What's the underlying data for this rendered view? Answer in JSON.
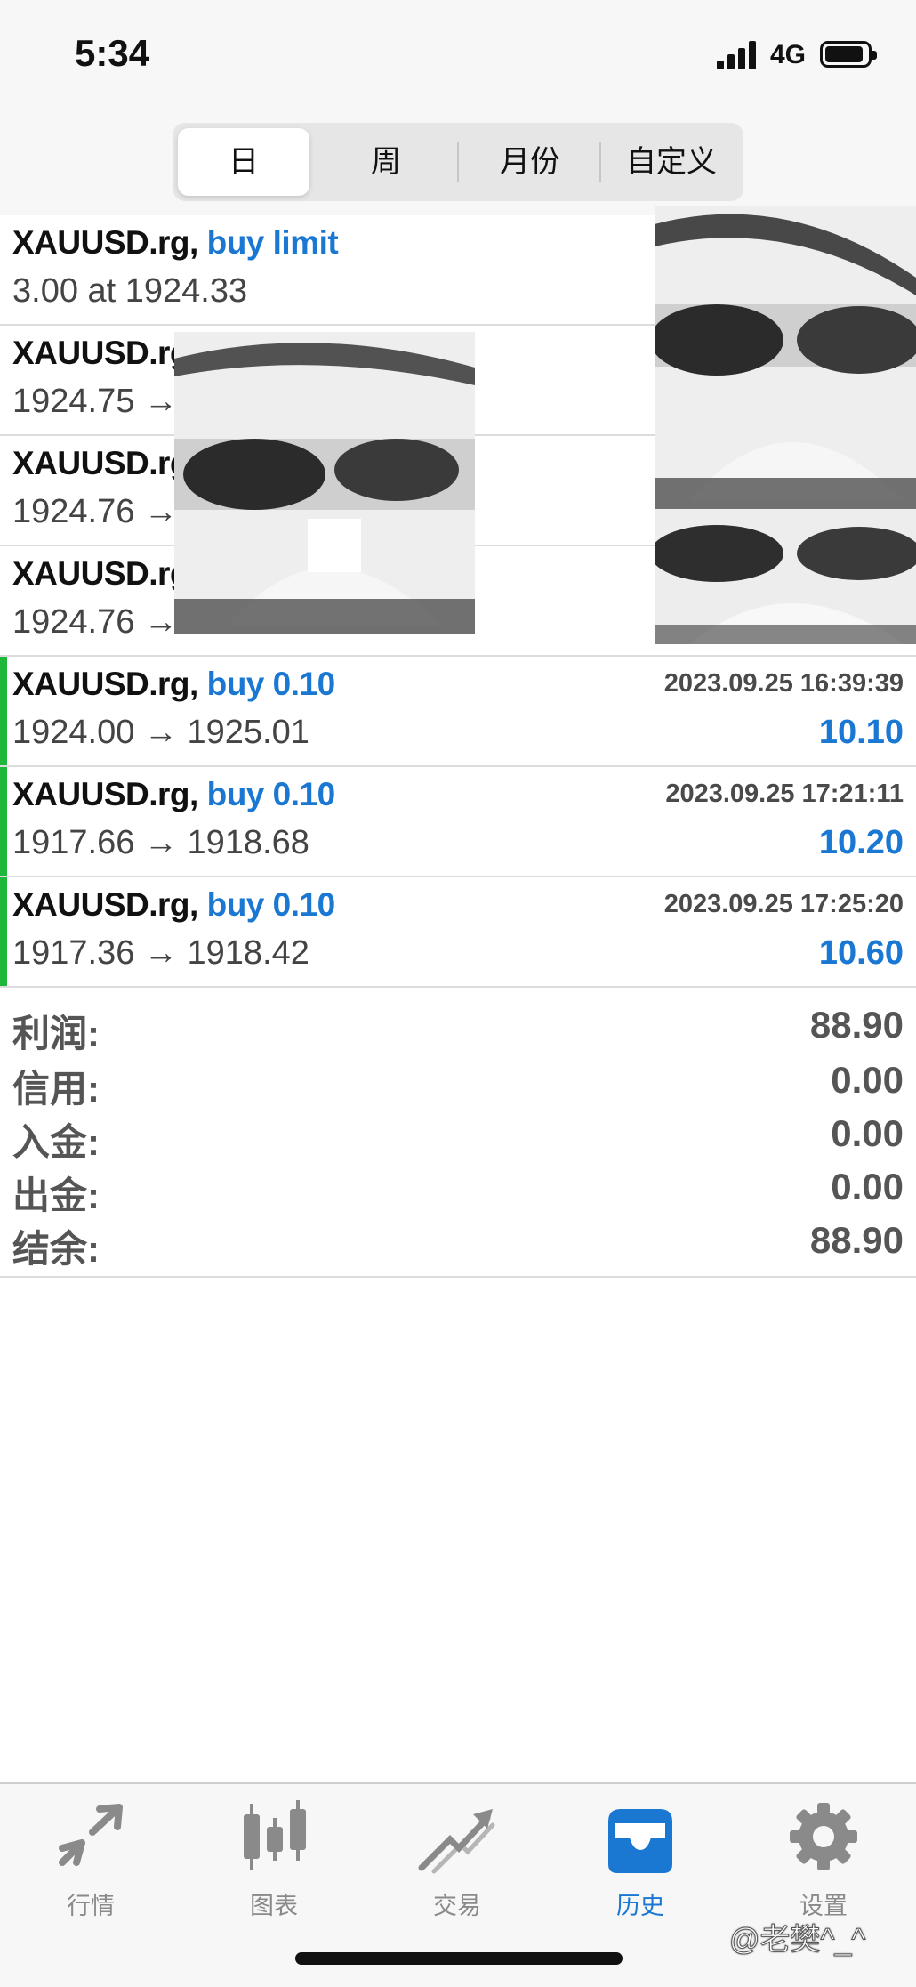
{
  "status_bar": {
    "time": "5:34",
    "network": "4G"
  },
  "tabs_period": {
    "options": [
      "日",
      "周",
      "月份",
      "自定义"
    ],
    "selected": "日"
  },
  "orders": [
    {
      "symbol": "XAUUSD.rg,",
      "action": "buy limit",
      "price_line": "3.00 at 1924.33",
      "date": "",
      "profit": ""
    },
    {
      "symbol": "XAUUSD.rg",
      "action": "",
      "price_line": "1924.75 →",
      "date": "",
      "profit": ""
    },
    {
      "symbol": "XAUUSD.rg",
      "action": "",
      "price_line": "1924.76 →",
      "date": "",
      "profit": ""
    },
    {
      "symbol": "XAUUSD.rg",
      "action": "",
      "price_line": "1924.76 →",
      "date": "",
      "profit": ""
    },
    {
      "symbol": "XAUUSD.rg,",
      "action": "buy 0.10",
      "price_line": "1924.00 → 1925.01",
      "date": "2023.09.25 16:39:39",
      "profit": "10.10"
    },
    {
      "symbol": "XAUUSD.rg,",
      "action": "buy 0.10",
      "price_line": "1917.66 → 1918.68",
      "date": "2023.09.25 17:21:11",
      "profit": "10.20"
    },
    {
      "symbol": "XAUUSD.rg,",
      "action": "buy 0.10",
      "price_line": "1917.36 → 1918.42",
      "date": "2023.09.25 17:25:20",
      "profit": "10.60"
    }
  ],
  "summary": {
    "profit_label": "利润:",
    "profit_value": "88.90",
    "credit_label": "信用:",
    "credit_value": "0.00",
    "deposit_label": "入金:",
    "deposit_value": "0.00",
    "withdraw_label": "出金:",
    "withdraw_value": "0.00",
    "balance_label": "结余:",
    "balance_value": "88.90"
  },
  "tabbar": {
    "items": [
      {
        "label": "行情",
        "icon": "quotes-arrows-icon"
      },
      {
        "label": "图表",
        "icon": "candlestick-chart-icon"
      },
      {
        "label": "交易",
        "icon": "trade-chart-icon"
      },
      {
        "label": "历史",
        "icon": "history-inbox-icon"
      },
      {
        "label": "设置",
        "icon": "gear-icon"
      }
    ],
    "active": "历史"
  },
  "watermark": "@老樊^_^",
  "colors": {
    "accent": "#1a77d2",
    "green_marker": "#1fb73a",
    "text_gray": "#555555"
  }
}
